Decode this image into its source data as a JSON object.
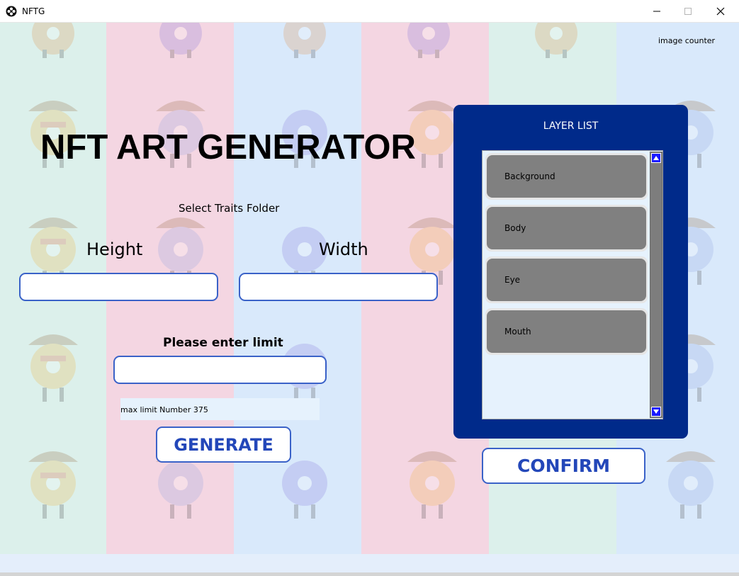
{
  "window": {
    "title": "NFTG",
    "icons": {
      "app": "app-logo-icon",
      "minimize": "minimize-icon",
      "maximize": "maximize-icon",
      "close": "close-icon"
    }
  },
  "colors": {
    "stripe_green": "#dcf0eb",
    "stripe_pink": "#f4d6e2",
    "stripe_blue": "#d9e9fb",
    "panel_blue": "#002a8a",
    "button_text": "#2347b9",
    "input_border": "#3a62c8",
    "layer_item": "#808080",
    "scroll_button": "#1a1aff"
  },
  "header": {
    "image_counter": "image counter",
    "title": "NFT ART GENERATOR"
  },
  "form": {
    "select_traits_folder": "Select Traits Folder",
    "height_label": "Height",
    "width_label": "Width",
    "height_value": "",
    "width_value": "",
    "limit_label": "Please enter limit",
    "limit_value": "",
    "max_limit_text": "max limit Number 375",
    "generate_label": "GENERATE"
  },
  "layers": {
    "title": "LAYER LIST",
    "items": [
      {
        "label": "Background"
      },
      {
        "label": "Body"
      },
      {
        "label": "Eye"
      },
      {
        "label": "Mouth"
      }
    ],
    "confirm_label": "CONFIRM"
  }
}
